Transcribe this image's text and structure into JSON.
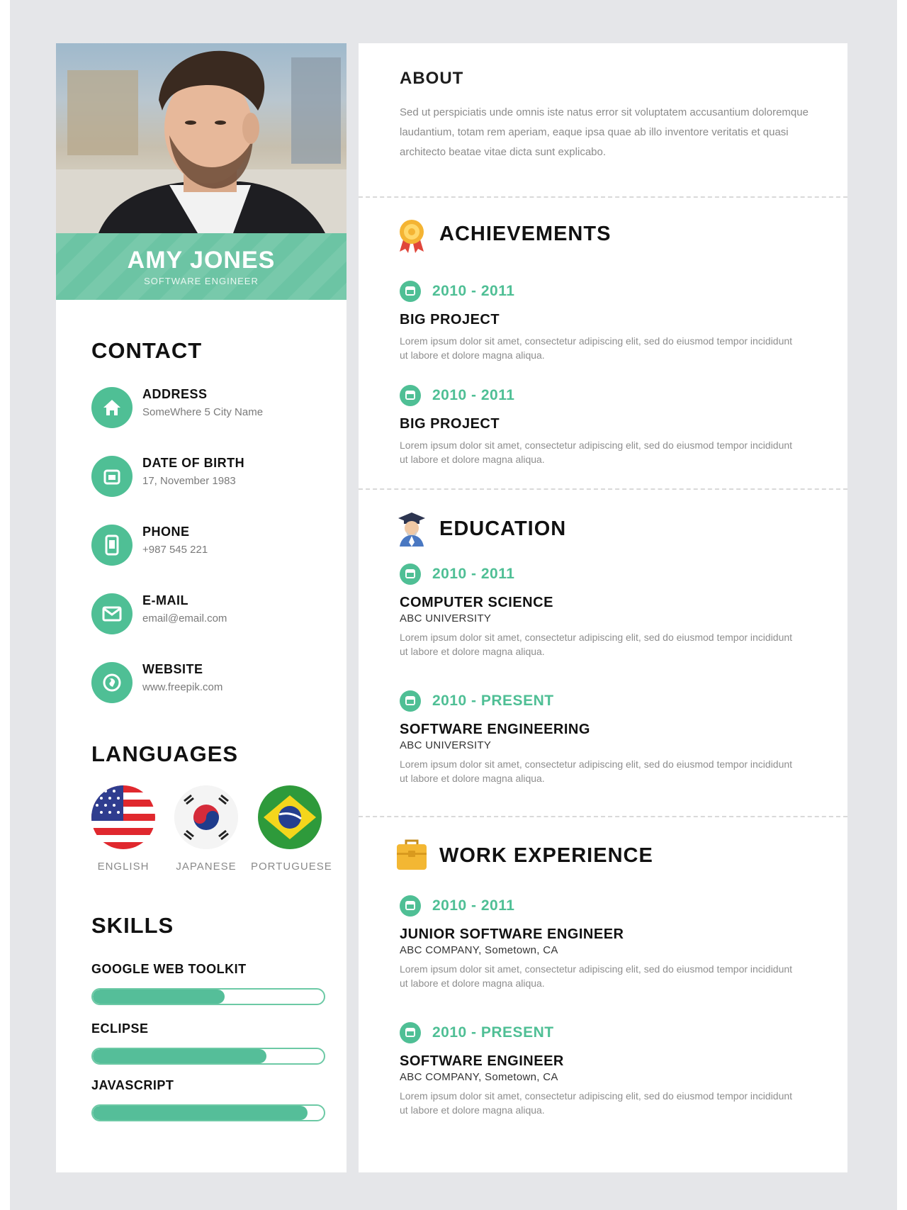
{
  "profile": {
    "name": "AMY JONES",
    "role": "SOFTWARE ENGINEER"
  },
  "contact": {
    "heading": "CONTACT",
    "items": [
      {
        "label": "ADDRESS",
        "value": "SomeWhere 5 City Name",
        "icon": "home-icon"
      },
      {
        "label": "DATE OF BIRTH",
        "value": "17, November 1983",
        "icon": "calendar-icon"
      },
      {
        "label": "PHONE",
        "value": "+987 545 221",
        "icon": "phone-icon"
      },
      {
        "label": "E-MAIL",
        "value": "email@email.com",
        "icon": "mail-icon"
      },
      {
        "label": "WEBSITE",
        "value": "www.freepik.com",
        "icon": "globe-icon"
      }
    ]
  },
  "languages": {
    "heading": "LANGUAGES",
    "items": [
      {
        "name": "ENGLISH",
        "flag": "us-flag-icon"
      },
      {
        "name": "JAPANESE",
        "flag": "korea-flag-icon"
      },
      {
        "name": "PORTUGUESE",
        "flag": "brazil-flag-icon"
      }
    ]
  },
  "skills": {
    "heading": "SKILLS",
    "items": [
      {
        "name": "GOOGLE WEB TOOLKIT",
        "level": 0.57
      },
      {
        "name": "ECLIPSE",
        "level": 0.75
      },
      {
        "name": "JAVASCRIPT",
        "level": 0.93
      }
    ]
  },
  "about": {
    "heading": "ABOUT",
    "text": "Sed ut perspiciatis unde omnis iste natus error sit voluptatem accusantium doloremque laudantium, totam rem aperiam, eaque ipsa quae ab illo inventore veritatis et quasi architecto beatae vitae dicta sunt explicabo."
  },
  "achievements": {
    "heading": "ACHIEVEMENTS",
    "icon": "award-medal-icon",
    "items": [
      {
        "date": "2010 - 2011",
        "title": "BIG PROJECT",
        "desc": "Lorem ipsum dolor sit amet, consectetur adipiscing elit, sed do eiusmod tempor incididunt ut labore et dolore magna aliqua."
      },
      {
        "date": "2010 - 2011",
        "title": "BIG PROJECT",
        "desc": "Lorem ipsum dolor sit amet, consectetur adipiscing elit, sed do eiusmod tempor incididunt ut labore et dolore magna aliqua."
      }
    ]
  },
  "education": {
    "heading": "EDUCATION",
    "icon": "graduate-icon",
    "items": [
      {
        "date": "2010 - 2011",
        "title": "COMPUTER SCIENCE",
        "sub": "ABC UNIVERSITY",
        "desc": "Lorem ipsum dolor sit amet, consectetur adipiscing elit, sed do eiusmod tempor incididunt ut labore et dolore magna aliqua."
      },
      {
        "date": "2010 - PRESENT",
        "title": "SOFTWARE ENGINEERING",
        "sub": "ABC UNIVERSITY",
        "desc": "Lorem ipsum dolor sit amet, consectetur adipiscing elit, sed do eiusmod tempor incididunt ut labore et dolore magna aliqua."
      }
    ]
  },
  "work": {
    "heading": "WORK EXPERIENCE",
    "icon": "briefcase-icon",
    "items": [
      {
        "date": "2010 - 2011",
        "title": "JUNIOR SOFTWARE ENGINEER",
        "sub": "ABC COMPANY, Sometown, CA",
        "desc": "Lorem ipsum dolor sit amet, consectetur adipiscing elit, sed do eiusmod tempor incididunt ut labore et dolore magna aliqua."
      },
      {
        "date": "2010 - PRESENT",
        "title": "SOFTWARE ENGINEER",
        "sub": "ABC COMPANY, Sometown, CA",
        "desc": "Lorem ipsum dolor sit amet, consectetur adipiscing elit, sed do eiusmod tempor incididunt ut labore et dolore magna aliqua."
      }
    ]
  },
  "colors": {
    "accent": "#4fbf95",
    "band": "#6cc4a4",
    "background": "#e5e6e9"
  }
}
